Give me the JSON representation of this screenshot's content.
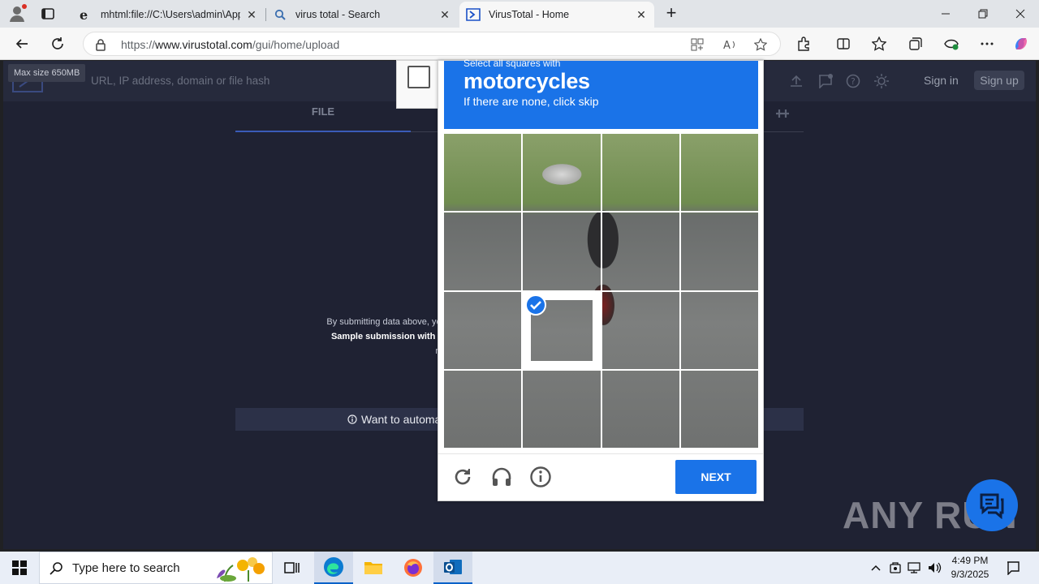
{
  "browser": {
    "tabs": [
      {
        "title": "mhtml:file://C:\\Users\\admin\\AppD",
        "icon": "ie-icon",
        "active": false
      },
      {
        "title": "virus total - Search",
        "icon": "search-icon",
        "active": false
      },
      {
        "title": "VirusTotal - Home",
        "icon": "virustotal-icon",
        "active": true
      }
    ],
    "url_prefix": "https://",
    "url_host": "www.virustotal.com",
    "url_path": "/gui/home/upload"
  },
  "page": {
    "search_placeholder": "URL, IP address, domain or file hash",
    "tooltip": "Max size 650MB",
    "sign_in": "Sign in",
    "sign_up": "Sign up",
    "file_tab": "FILE",
    "disclaimer_line1": "By submitting data above, you are ag",
    "disclaimer_line2": "Sample submission with the secu",
    "disclaimer_line3": "responsib",
    "automate_text": "Want to automa"
  },
  "captcha": {
    "pre_text": "Select all squares with",
    "target": "motorcycles",
    "subtitle": "If there are none, click skip",
    "next_label": "NEXT",
    "selected_tiles": [
      9
    ],
    "accent": "#1a73e8"
  },
  "overlay": {
    "watermark": "ANY RUN"
  },
  "taskbar": {
    "search_placeholder": "Type here to search",
    "time": "4:49 PM",
    "date": "9/3/2025"
  }
}
